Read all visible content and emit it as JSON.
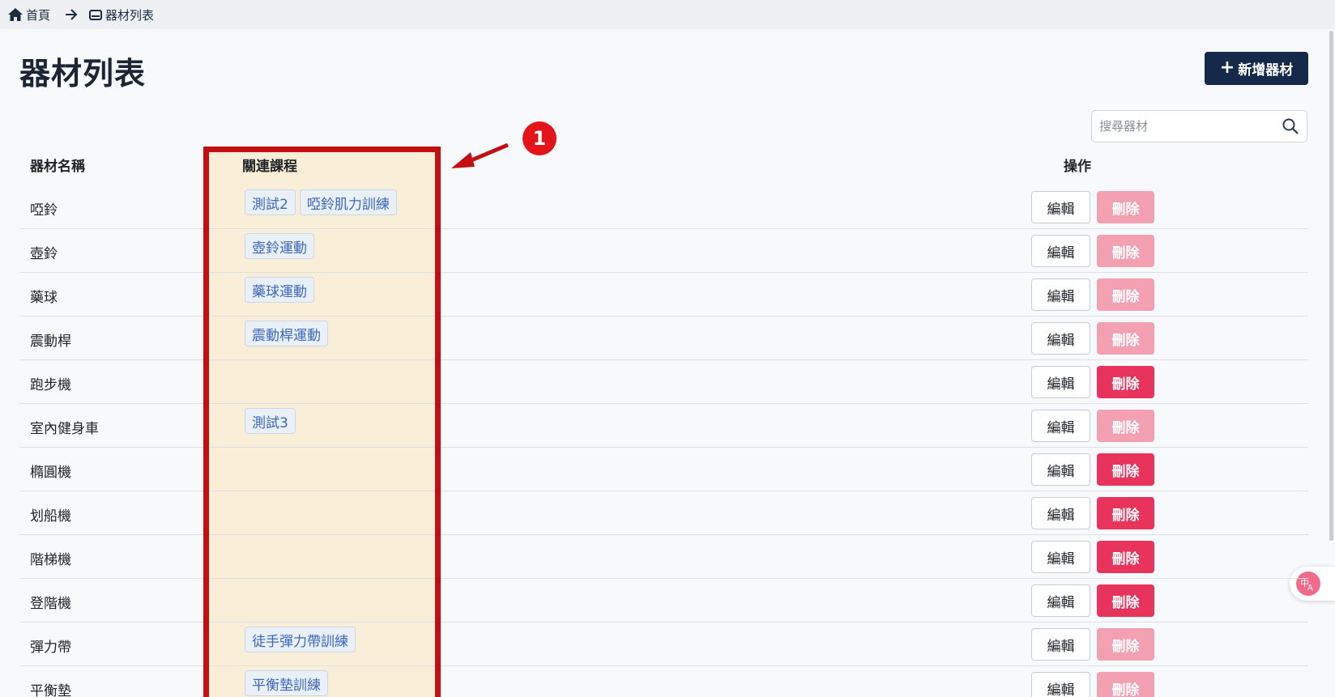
{
  "breadcrumb": {
    "home_label": "首頁",
    "current_label": "器材列表"
  },
  "page": {
    "title": "器材列表",
    "add_button_label": "新增器材"
  },
  "search": {
    "placeholder": "搜尋器材",
    "value": ""
  },
  "table": {
    "headers": {
      "name": "器材名稱",
      "courses": "關連課程",
      "actions": "操作"
    },
    "edit_label": "編輯",
    "delete_label": "刪除",
    "rows": [
      {
        "name": "啞鈴",
        "courses": [
          "測試2",
          "啞鈴肌力訓練"
        ],
        "delete_enabled": false
      },
      {
        "name": "壺鈴",
        "courses": [
          "壺鈴運動"
        ],
        "delete_enabled": false
      },
      {
        "name": "藥球",
        "courses": [
          "藥球運動"
        ],
        "delete_enabled": false
      },
      {
        "name": "震動桿",
        "courses": [
          "震動桿運動"
        ],
        "delete_enabled": false
      },
      {
        "name": "跑步機",
        "courses": [],
        "delete_enabled": true
      },
      {
        "name": "室內健身車",
        "courses": [
          "測試3"
        ],
        "delete_enabled": false
      },
      {
        "name": "橢圓機",
        "courses": [],
        "delete_enabled": true
      },
      {
        "name": "划船機",
        "courses": [],
        "delete_enabled": true
      },
      {
        "name": "階梯機",
        "courses": [],
        "delete_enabled": true
      },
      {
        "name": "登階機",
        "courses": [],
        "delete_enabled": true
      },
      {
        "name": "彈力帶",
        "courses": [
          "徒手彈力帶訓練"
        ],
        "delete_enabled": false
      },
      {
        "name": "平衡墊",
        "courses": [
          "平衡墊訓練"
        ],
        "delete_enabled": false
      }
    ]
  },
  "annotation": {
    "badge_number": "1",
    "highlight_color": "#c40f12"
  },
  "colors": {
    "primary": "#15294a",
    "delete_enabled": "#e8345c",
    "delete_disabled": "#f2a0b2",
    "tag_text": "#3d67b8"
  },
  "icons": {
    "home": "home-icon",
    "arrow": "arrow-right-icon",
    "list": "equipment-icon",
    "search": "search-icon",
    "translate": "translate-icon"
  }
}
